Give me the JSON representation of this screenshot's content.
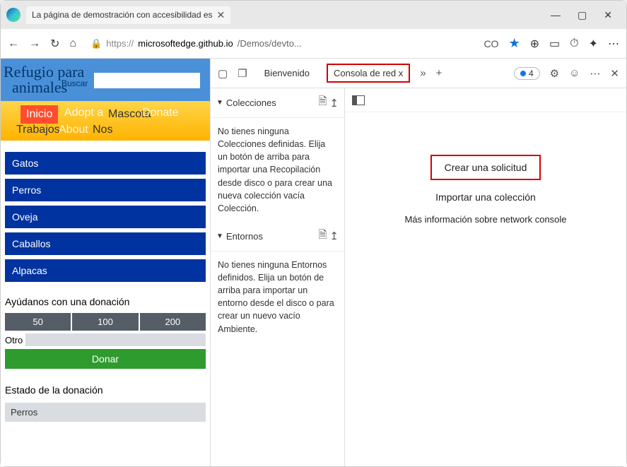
{
  "window": {
    "tab_title": "La página de demostración con accesibilidad es",
    "win_min": "—",
    "win_max": "▢",
    "win_close": "✕"
  },
  "toolbar": {
    "url_host": "microsoftedge.github.io",
    "url_path": "/Demos/devto...",
    "co": "CO"
  },
  "page": {
    "title_line1": "Refugio para",
    "title_line2": "animales",
    "search_label": "Buscar",
    "nav": {
      "inicio": "Inicio",
      "adopt": "Adopt a",
      "mascota": "Mascota",
      "donate": "Donate",
      "trabajos": "Trabajos",
      "about": "About",
      "nos": "Nos"
    },
    "animals": [
      "Gatos",
      "Perros",
      "Oveja",
      "Caballos",
      "Alpacas"
    ],
    "donate_label": "Ayúdanos con una donación",
    "donate_amounts": [
      "50",
      "100",
      "200"
    ],
    "otro": "Otro",
    "donar": "Donar",
    "status_label": "Estado de la donación",
    "status_item": "Perros"
  },
  "devtools": {
    "tabs": {
      "welcome": "Bienvenido",
      "network": "Consola de red x"
    },
    "badge_count": "4",
    "collections_header": "Colecciones",
    "collections_text": "No tienes ninguna Colecciones definidas. Elija un botón de arriba para importar una Recopilación desde disco o para crear una nueva colección vacía Colección.",
    "environments_header": "Entornos",
    "environments_text": "No tienes ninguna Entornos definidos. Elija un botón de arriba para importar un entorno desde el disco o para crear un nuevo vacío Ambiente.",
    "create_request": "Crear una solicitud",
    "import_collection": "Importar una colección",
    "more_info": "Más información sobre network console"
  }
}
